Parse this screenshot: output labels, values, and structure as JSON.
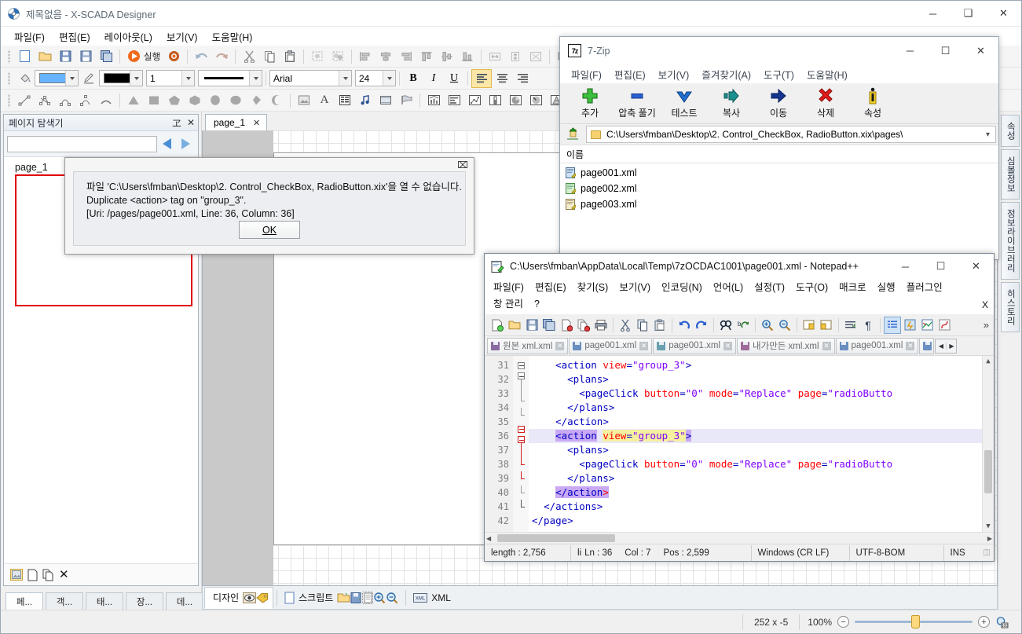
{
  "app": {
    "title": "제목없음 - X-SCADA Designer",
    "icon": "xscada-logo-icon",
    "window_buttons": {
      "minimize": "─",
      "maximize": "❑",
      "close": "✕"
    },
    "menu": [
      {
        "label": "파일(F)",
        "name": "menu-file"
      },
      {
        "label": "편집(E)",
        "name": "menu-edit"
      },
      {
        "label": "레이아웃(L)",
        "name": "menu-layout"
      },
      {
        "label": "보기(V)",
        "name": "menu-view"
      },
      {
        "label": "도움말(H)",
        "name": "menu-help"
      }
    ],
    "toolbar_run_label": "실행",
    "format": {
      "fill_color": "#66b3ff",
      "line_color": "#000000",
      "line_width": "1",
      "font_family": "Arial",
      "font_size": "24",
      "bold": "B",
      "italic": "I",
      "underline": "U"
    }
  },
  "page_explorer": {
    "title": "페이지 탐색기",
    "pin": "ヱ",
    "close": "✕",
    "search_value": "",
    "search_placeholder": "",
    "tree_root": "page_1",
    "tabs": [
      {
        "label": "페...",
        "name": "dock-tab-page",
        "active": true
      },
      {
        "label": "객...",
        "name": "dock-tab-object",
        "active": false
      },
      {
        "label": "태...",
        "name": "dock-tab-tag",
        "active": false
      },
      {
        "label": "장...",
        "name": "dock-tab-device",
        "active": false
      },
      {
        "label": "데...",
        "name": "dock-tab-data",
        "active": false
      }
    ]
  },
  "document": {
    "tab_label": "page_1",
    "tab_close": "✕"
  },
  "design_toolbar": {
    "design_label": "디자인",
    "script_label": "스크립트",
    "xml_label": "XML"
  },
  "right_dock_tabs": [
    {
      "label": "속성",
      "name": "vtab-properties"
    },
    {
      "label": "심볼정보",
      "name": "vtab-symbol-info"
    },
    {
      "label": "정보라이브러리",
      "name": "vtab-info-library"
    },
    {
      "label": "히스토리",
      "name": "vtab-history"
    }
  ],
  "statusbar": {
    "coordinates": "252 x -5",
    "zoom_level": "100%",
    "zoom_out": "−",
    "zoom_in": "+"
  },
  "dialog": {
    "close": "⌧",
    "line1": "파일 'C:\\Users\\fmban\\Desktop\\2. Control_CheckBox, RadioButton.xix'을 열 수 없습니다.",
    "line2": "Duplicate <action> tag on \"group_3\".",
    "line3": "[Uri: /pages/page001.xml, Line: 36, Column: 36]",
    "ok_label": "OK"
  },
  "sevenzip": {
    "title": "7-Zip",
    "logo": "7z",
    "window_buttons": {
      "minimize": "─",
      "maximize": "☐",
      "close": "✕"
    },
    "menu": [
      {
        "label": "파일(F)",
        "name": "zip-menu-file"
      },
      {
        "label": "편집(E)",
        "name": "zip-menu-edit"
      },
      {
        "label": "보기(V)",
        "name": "zip-menu-view"
      },
      {
        "label": "즐겨찾기(A)",
        "name": "zip-menu-favorites"
      },
      {
        "label": "도구(T)",
        "name": "zip-menu-tools"
      },
      {
        "label": "도움말(H)",
        "name": "zip-menu-help"
      }
    ],
    "toolbar": [
      {
        "label": "추가",
        "name": "zip-add-button",
        "icon": "plus-icon"
      },
      {
        "label": "압축 풀기",
        "name": "zip-extract-button",
        "icon": "minus-bar-icon"
      },
      {
        "label": "테스트",
        "name": "zip-test-button",
        "icon": "chevron-down-icon"
      },
      {
        "label": "복사",
        "name": "zip-copy-button",
        "icon": "arrow-right-teal-icon"
      },
      {
        "label": "이동",
        "name": "zip-move-button",
        "icon": "arrow-right-navy-icon"
      },
      {
        "label": "삭제",
        "name": "zip-delete-button",
        "icon": "red-x-icon"
      },
      {
        "label": "속성",
        "name": "zip-properties-button",
        "icon": "info-icon"
      }
    ],
    "address": "C:\\Users\\fmban\\Desktop\\2. Control_CheckBox, RadioButton.xix\\pages\\",
    "column_header": "이름",
    "files": [
      {
        "name": "page001.xml"
      },
      {
        "name": "page002.xml"
      },
      {
        "name": "page003.xml"
      }
    ]
  },
  "notepadpp": {
    "title": "C:\\Users\\fmban\\AppData\\Local\\Temp\\7zOCDAC1001\\page001.xml - Notepad++",
    "window_buttons": {
      "minimize": "─",
      "maximize": "☐",
      "close": "✕"
    },
    "menu_row1": [
      {
        "label": "파일(F)",
        "name": "npp-menu-file"
      },
      {
        "label": "편집(E)",
        "name": "npp-menu-edit"
      },
      {
        "label": "찾기(S)",
        "name": "npp-menu-search"
      },
      {
        "label": "보기(V)",
        "name": "npp-menu-view"
      },
      {
        "label": "인코딩(N)",
        "name": "npp-menu-encoding"
      },
      {
        "label": "언어(L)",
        "name": "npp-menu-language"
      },
      {
        "label": "설정(T)",
        "name": "npp-menu-settings"
      },
      {
        "label": "도구(O)",
        "name": "npp-menu-tools"
      },
      {
        "label": "매크로",
        "name": "npp-menu-macro"
      },
      {
        "label": "실행",
        "name": "npp-menu-run"
      },
      {
        "label": "플러그인",
        "name": "npp-menu-plugins"
      }
    ],
    "menu_row2": [
      {
        "label": "창 관리",
        "name": "npp-menu-window"
      },
      {
        "label": "?",
        "name": "npp-menu-about"
      }
    ],
    "menu_close": "X",
    "toolbar_overflow": "»",
    "tabs": [
      {
        "label": "원본 xml.xml",
        "name": "npp-tab-original-xml",
        "active": false
      },
      {
        "label": "page001.xml",
        "name": "npp-tab-page001-a",
        "active": false
      },
      {
        "label": "page001.xml",
        "name": "npp-tab-page001-b",
        "active": false
      },
      {
        "label": "내가만든 xml.xml",
        "name": "npp-tab-mine-xml",
        "active": false
      },
      {
        "label": "page001.xml",
        "name": "npp-tab-page001-c",
        "active": true
      }
    ],
    "tab_close_glyph": "✕",
    "tab_scroll_left": "◀",
    "tab_scroll_right": "▶",
    "code_lines": [
      {
        "n": "31",
        "indent": 4,
        "fold": "box",
        "tokens": [
          {
            "t": "<action",
            "c": "tg"
          },
          {
            "t": " ",
            "c": ""
          },
          {
            "t": "view",
            "c": "at"
          },
          {
            "t": "=",
            "c": "tg"
          },
          {
            "t": "\"group_3\"",
            "c": "av"
          },
          {
            "t": ">",
            "c": "tg"
          }
        ]
      },
      {
        "n": "32",
        "indent": 6,
        "fold": "box",
        "tokens": [
          {
            "t": "<plans>",
            "c": "tg"
          }
        ]
      },
      {
        "n": "33",
        "indent": 8,
        "fold": "line",
        "tokens": [
          {
            "t": "<pageClick",
            "c": "tg"
          },
          {
            "t": " ",
            "c": ""
          },
          {
            "t": "button",
            "c": "at"
          },
          {
            "t": "=",
            "c": "tg"
          },
          {
            "t": "\"0\"",
            "c": "av"
          },
          {
            "t": " ",
            "c": ""
          },
          {
            "t": "mode",
            "c": "at"
          },
          {
            "t": "=",
            "c": "tg"
          },
          {
            "t": "\"Replace\"",
            "c": "av"
          },
          {
            "t": " ",
            "c": ""
          },
          {
            "t": "page",
            "c": "at"
          },
          {
            "t": "=",
            "c": "tg"
          },
          {
            "t": "\"radioButto",
            "c": "av"
          }
        ]
      },
      {
        "n": "34",
        "indent": 6,
        "fold": "tick",
        "tokens": [
          {
            "t": "</plans>",
            "c": "tg"
          }
        ]
      },
      {
        "n": "35",
        "indent": 4,
        "fold": "tick",
        "tokens": [
          {
            "t": "</action>",
            "c": "tg"
          }
        ]
      },
      {
        "n": "36",
        "indent": 4,
        "fold": "box-red",
        "highlight": true,
        "tokens": [
          {
            "t": "<",
            "c": "tg selpurple"
          },
          {
            "t": "a",
            "c": "tg selpurple caret-after"
          },
          {
            "t": "ction",
            "c": "tg selpurple"
          },
          {
            "t": " ",
            "c": ""
          },
          {
            "t": "view",
            "c": "at selyellow"
          },
          {
            "t": "=",
            "c": "tg selyellow"
          },
          {
            "t": "\"group_3\"",
            "c": "av selyellow"
          },
          {
            "t": ">",
            "c": "tg selpurple"
          }
        ]
      },
      {
        "n": "37",
        "indent": 6,
        "fold": "box-red",
        "tokens": [
          {
            "t": "<plans>",
            "c": "tg"
          }
        ]
      },
      {
        "n": "38",
        "indent": 8,
        "fold": "line-red",
        "tokens": [
          {
            "t": "<pageClick",
            "c": "tg"
          },
          {
            "t": " ",
            "c": ""
          },
          {
            "t": "button",
            "c": "at"
          },
          {
            "t": "=",
            "c": "tg"
          },
          {
            "t": "\"0\"",
            "c": "av"
          },
          {
            "t": " ",
            "c": ""
          },
          {
            "t": "mode",
            "c": "at"
          },
          {
            "t": "=",
            "c": "tg"
          },
          {
            "t": "\"Replace\"",
            "c": "av"
          },
          {
            "t": " ",
            "c": ""
          },
          {
            "t": "page",
            "c": "at"
          },
          {
            "t": "=",
            "c": "tg"
          },
          {
            "t": "\"radioButto",
            "c": "av"
          }
        ]
      },
      {
        "n": "39",
        "indent": 6,
        "fold": "tick-red",
        "tokens": [
          {
            "t": "</plans>",
            "c": "tg"
          }
        ]
      },
      {
        "n": "40",
        "indent": 4,
        "fold": "tick-red",
        "tokens": [
          {
            "t": "</action",
            "c": "tg selpurple"
          },
          {
            "t": ">",
            "c": "at selpurple"
          }
        ]
      },
      {
        "n": "41",
        "indent": 2,
        "fold": "tick",
        "tokens": [
          {
            "t": "</actions>",
            "c": "tg"
          }
        ]
      },
      {
        "n": "42",
        "indent": 0,
        "fold": "end",
        "tokens": [
          {
            "t": "</page>",
            "c": "tg"
          }
        ]
      }
    ],
    "status": {
      "length": "length : 2,756",
      "lines": "li",
      "ln": "Ln : 36",
      "col": "Col : 7",
      "pos": "Pos : 2,599",
      "eol": "Windows (CR LF)",
      "encoding": "UTF-8-BOM",
      "insert_mode": "INS"
    }
  }
}
